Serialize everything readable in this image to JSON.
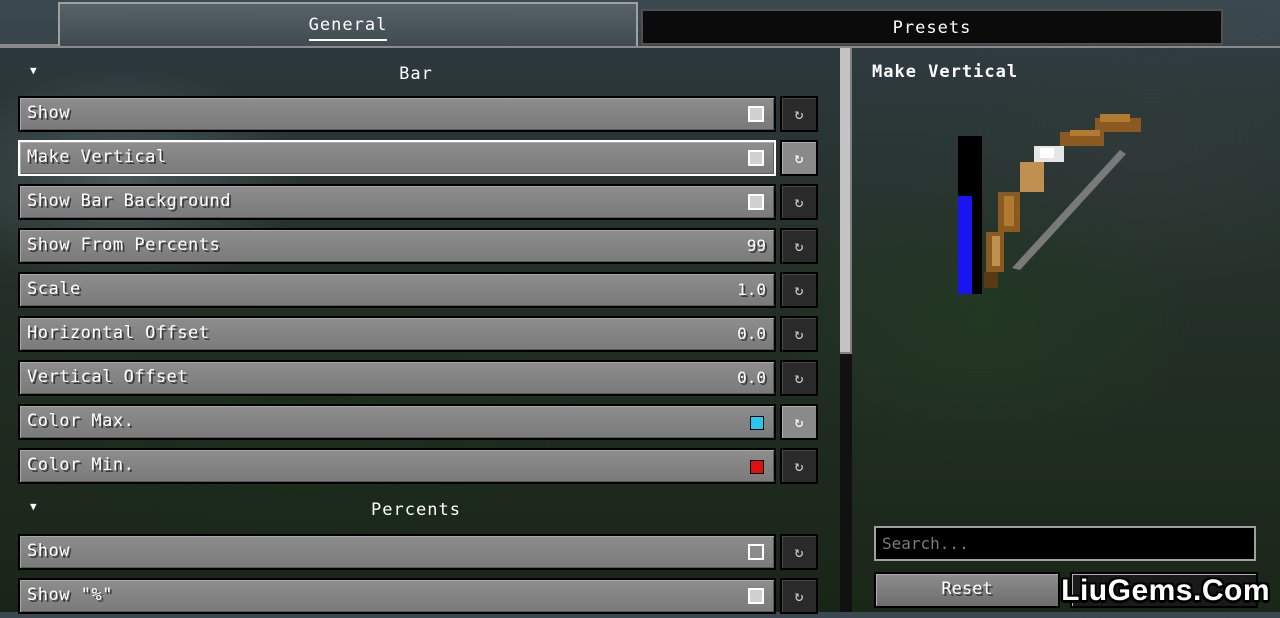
{
  "tabs": [
    {
      "label": "General",
      "active": true
    },
    {
      "label": "Presets",
      "active": false
    }
  ],
  "sections": {
    "bar": {
      "title": "Bar",
      "rows": [
        {
          "label": "Show",
          "kind": "checkbox",
          "checked": true
        },
        {
          "label": "Make Vertical",
          "kind": "checkbox",
          "checked": true,
          "focused": true
        },
        {
          "label": "Show Bar Background",
          "kind": "checkbox",
          "checked": true
        },
        {
          "label": "Show From Percents",
          "kind": "number",
          "value": "99"
        },
        {
          "label": "Scale",
          "kind": "number",
          "value": "1.0"
        },
        {
          "label": "Horizontal Offset",
          "kind": "number",
          "value": "0.0"
        },
        {
          "label": "Vertical Offset",
          "kind": "number",
          "value": "0.0"
        },
        {
          "label": "Color Max.",
          "kind": "color",
          "color": "#29c6f0"
        },
        {
          "label": "Color Min.",
          "kind": "color",
          "color": "#e01010"
        }
      ]
    },
    "percents": {
      "title": "Percents",
      "rows": [
        {
          "label": "Show",
          "kind": "checkbox",
          "checked": false
        },
        {
          "label": "Show \"%\"",
          "kind": "checkbox",
          "checked": true
        }
      ]
    }
  },
  "reset_icon": "↻",
  "description": {
    "title": "Make Vertical"
  },
  "preview": {
    "bar_fill_fraction": 0.62,
    "bar_color": "#1a14f0"
  },
  "search": {
    "placeholder": "Search..."
  },
  "buttons": {
    "reset": "Reset"
  },
  "watermark": "LiuGems.Com"
}
